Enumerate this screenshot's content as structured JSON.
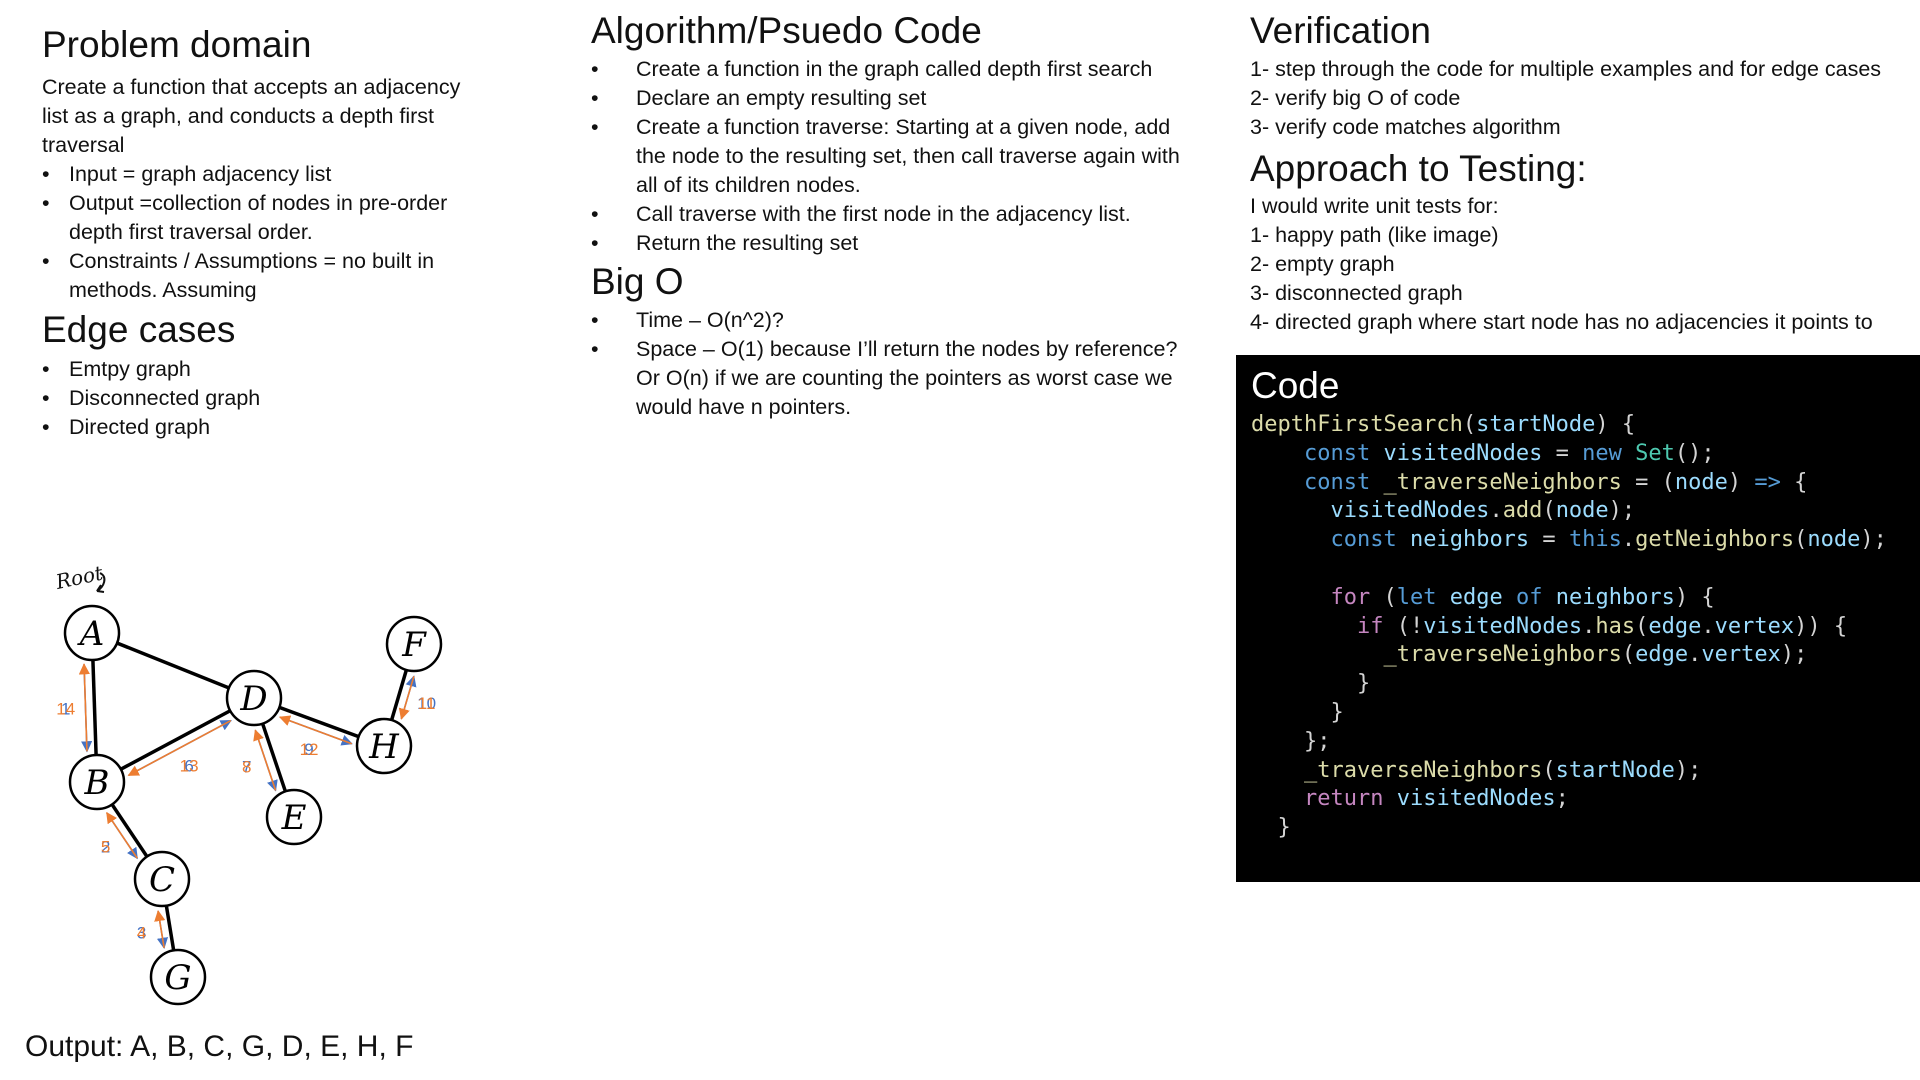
{
  "problem": {
    "title": "Problem domain",
    "description": "Create a function that accepts an adjacency list as a graph, and conducts a depth first traversal",
    "bullets": [
      "Input = graph adjacency list",
      "Output =collection of nodes in pre-order depth first traversal order.",
      "Constraints / Assumptions = no built in methods. Assuming"
    ]
  },
  "edge_cases": {
    "title": "Edge cases",
    "bullets": [
      "Emtpy graph",
      "Disconnected graph",
      "Directed graph"
    ]
  },
  "algorithm": {
    "title": "Algorithm/Psuedo Code",
    "bullets": [
      "Create a function in the graph called depth first search",
      "Declare an empty resulting set",
      "Create a function traverse: Starting at a given node, add the node to the resulting set, then call traverse again with all of its children nodes.",
      " Call traverse with the first node in the adjacency list.",
      "Return the resulting set"
    ]
  },
  "big_o": {
    "title": "Big O",
    "bullets": [
      "Time –  O(n^2)?",
      "Space –  O(1) because I’ll return the nodes by reference? Or O(n) if we are counting the pointers as worst case we would have n pointers."
    ]
  },
  "verification": {
    "title": "Verification",
    "items": [
      "1- step through the code for multiple examples and for edge cases",
      "2- verify big O of code",
      "3- verify code matches algorithm"
    ]
  },
  "testing": {
    "title": "Approach to Testing:",
    "intro": "I would write unit tests for:",
    "items": [
      "1- happy path (like image)",
      "2- empty graph",
      "3- disconnected graph",
      "4- directed graph where start node has no adjacencies it points to"
    ]
  },
  "code": {
    "title": "Code",
    "lines": [
      [
        [
          "fn",
          "depthFirstSearch"
        ],
        [
          "pl",
          "("
        ],
        [
          "var",
          "startNode"
        ],
        [
          "pl",
          ") {"
        ]
      ],
      [
        [
          "pl",
          "    "
        ],
        [
          "kw",
          "const"
        ],
        [
          "pl",
          " "
        ],
        [
          "var",
          "visitedNodes"
        ],
        [
          "pl",
          " = "
        ],
        [
          "kw",
          "new"
        ],
        [
          "pl",
          " "
        ],
        [
          "cls",
          "Set"
        ],
        [
          "pl",
          "();"
        ]
      ],
      [
        [
          "pl",
          "    "
        ],
        [
          "kw",
          "const"
        ],
        [
          "pl",
          " "
        ],
        [
          "fn",
          "_traverseNeighbors"
        ],
        [
          "pl",
          " = ("
        ],
        [
          "var",
          "node"
        ],
        [
          "pl",
          ") "
        ],
        [
          "kw",
          "=>"
        ],
        [
          "pl",
          " {"
        ]
      ],
      [
        [
          "pl",
          "      "
        ],
        [
          "var",
          "visitedNodes"
        ],
        [
          "pl",
          "."
        ],
        [
          "fn",
          "add"
        ],
        [
          "pl",
          "("
        ],
        [
          "var",
          "node"
        ],
        [
          "pl",
          ");"
        ]
      ],
      [
        [
          "pl",
          "      "
        ],
        [
          "kw",
          "const"
        ],
        [
          "pl",
          " "
        ],
        [
          "var",
          "neighbors"
        ],
        [
          "pl",
          " = "
        ],
        [
          "kw",
          "this"
        ],
        [
          "pl",
          "."
        ],
        [
          "fn",
          "getNeighbors"
        ],
        [
          "pl",
          "("
        ],
        [
          "var",
          "node"
        ],
        [
          "pl",
          ");"
        ]
      ],
      [
        [
          "pl",
          ""
        ]
      ],
      [
        [
          "pl",
          "      "
        ],
        [
          "ctl",
          "for"
        ],
        [
          "pl",
          " ("
        ],
        [
          "kw",
          "let"
        ],
        [
          "pl",
          " "
        ],
        [
          "var",
          "edge"
        ],
        [
          "pl",
          " "
        ],
        [
          "kw",
          "of"
        ],
        [
          "pl",
          " "
        ],
        [
          "var",
          "neighbors"
        ],
        [
          "pl",
          ") {"
        ]
      ],
      [
        [
          "pl",
          "        "
        ],
        [
          "ctl",
          "if"
        ],
        [
          "pl",
          " (!"
        ],
        [
          "var",
          "visitedNodes"
        ],
        [
          "pl",
          "."
        ],
        [
          "fn",
          "has"
        ],
        [
          "pl",
          "("
        ],
        [
          "var",
          "edge"
        ],
        [
          "pl",
          "."
        ],
        [
          "var",
          "vertex"
        ],
        [
          "pl",
          ")) {"
        ]
      ],
      [
        [
          "pl",
          "          "
        ],
        [
          "fn",
          "_traverseNeighbors"
        ],
        [
          "pl",
          "("
        ],
        [
          "var",
          "edge"
        ],
        [
          "pl",
          "."
        ],
        [
          "var",
          "vertex"
        ],
        [
          "pl",
          ");"
        ]
      ],
      [
        [
          "pl",
          "        }"
        ]
      ],
      [
        [
          "pl",
          "      }"
        ]
      ],
      [
        [
          "pl",
          "    };"
        ]
      ],
      [
        [
          "pl",
          "    "
        ],
        [
          "fn",
          "_traverseNeighbors"
        ],
        [
          "pl",
          "("
        ],
        [
          "var",
          "startNode"
        ],
        [
          "pl",
          ");"
        ]
      ],
      [
        [
          "pl",
          "    "
        ],
        [
          "ctl",
          "return"
        ],
        [
          "pl",
          " "
        ],
        [
          "var",
          "visitedNodes"
        ],
        [
          "pl",
          ";"
        ]
      ],
      [
        [
          "pl",
          "  }"
        ]
      ]
    ]
  },
  "graph": {
    "root_label": "Root",
    "nodes": [
      {
        "id": "A",
        "label": "A"
      },
      {
        "id": "B",
        "label": "B"
      },
      {
        "id": "C",
        "label": "C"
      },
      {
        "id": "G",
        "label": "G"
      },
      {
        "id": "D",
        "label": "D"
      },
      {
        "id": "E",
        "label": "E"
      },
      {
        "id": "H",
        "label": "H"
      },
      {
        "id": "F",
        "label": "F"
      }
    ],
    "edges": [
      [
        "A",
        "B"
      ],
      [
        "A",
        "D"
      ],
      [
        "B",
        "C"
      ],
      [
        "C",
        "G"
      ],
      [
        "B",
        "D"
      ],
      [
        "D",
        "E"
      ],
      [
        "D",
        "H"
      ],
      [
        "H",
        "F"
      ]
    ],
    "traversal_steps": [
      {
        "step": "1",
        "from": "A",
        "to": "B",
        "direction": "forward"
      },
      {
        "step": "2",
        "from": "B",
        "to": "C",
        "direction": "forward"
      },
      {
        "step": "3",
        "from": "C",
        "to": "G",
        "direction": "forward"
      },
      {
        "step": "4",
        "from": "G",
        "to": "C",
        "direction": "backtrack"
      },
      {
        "step": "5",
        "from": "C",
        "to": "B",
        "direction": "backtrack"
      },
      {
        "step": "6",
        "from": "B",
        "to": "D",
        "direction": "forward"
      },
      {
        "step": "7",
        "from": "D",
        "to": "E",
        "direction": "forward"
      },
      {
        "step": "8",
        "from": "E",
        "to": "D",
        "direction": "backtrack"
      },
      {
        "step": "9",
        "from": "D",
        "to": "H",
        "direction": "forward"
      },
      {
        "step": "10",
        "from": "H",
        "to": "F",
        "direction": "forward"
      },
      {
        "step": "11",
        "from": "F",
        "to": "H",
        "direction": "backtrack"
      },
      {
        "step": "12",
        "from": "H",
        "to": "D",
        "direction": "backtrack"
      },
      {
        "step": "13",
        "from": "D",
        "to": "B",
        "direction": "backtrack"
      },
      {
        "step": "14",
        "from": "B",
        "to": "A",
        "direction": "backtrack"
      }
    ],
    "colors": {
      "forward": "#4472c4",
      "backtrack": "#ed7d31",
      "edge": "#000000"
    }
  },
  "output": "Output: A, B, C, G, D, E, H, F"
}
